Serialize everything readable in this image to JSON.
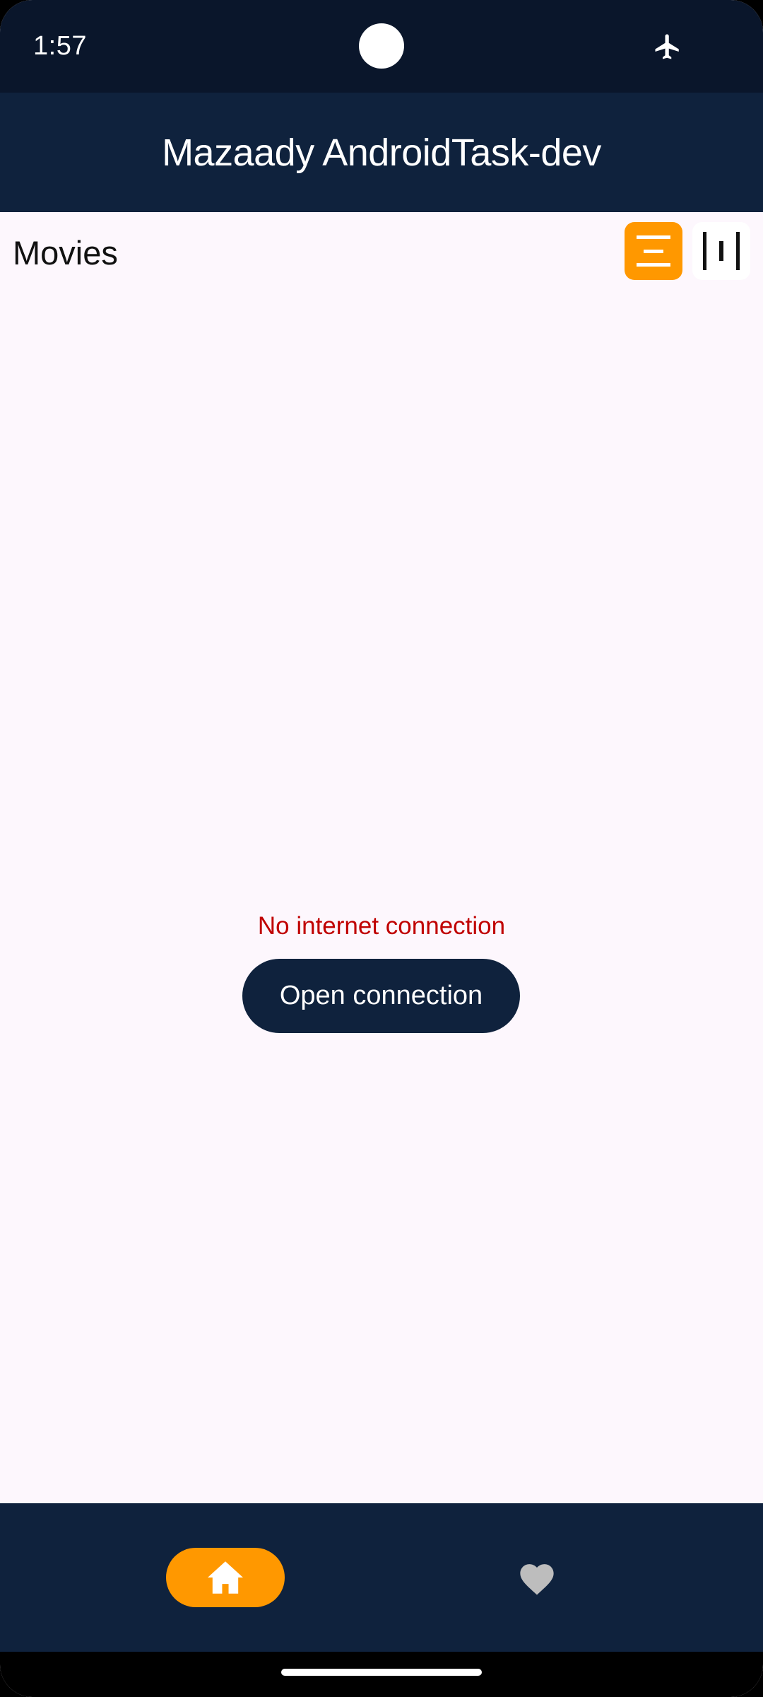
{
  "status_bar": {
    "time": "1:57",
    "airplane_mode_icon": "airplane-icon"
  },
  "app_bar": {
    "title": "Mazaady AndroidTask-dev"
  },
  "section": {
    "title": "Movies",
    "view_toggle": {
      "list_icon": "list-view-icon",
      "grid_icon": "grid-view-icon",
      "selected": "list"
    }
  },
  "error": {
    "message": "No internet connection",
    "button_label": "Open connection"
  },
  "bottom_nav": {
    "items": [
      {
        "icon": "home-icon",
        "selected": true
      },
      {
        "icon": "heart-icon",
        "selected": false
      }
    ]
  },
  "colors": {
    "accent": "#FF9800",
    "navy": "#0F223D",
    "status_bar": "#0A162B",
    "background": "#FDF7FD",
    "error": "#C00000"
  }
}
